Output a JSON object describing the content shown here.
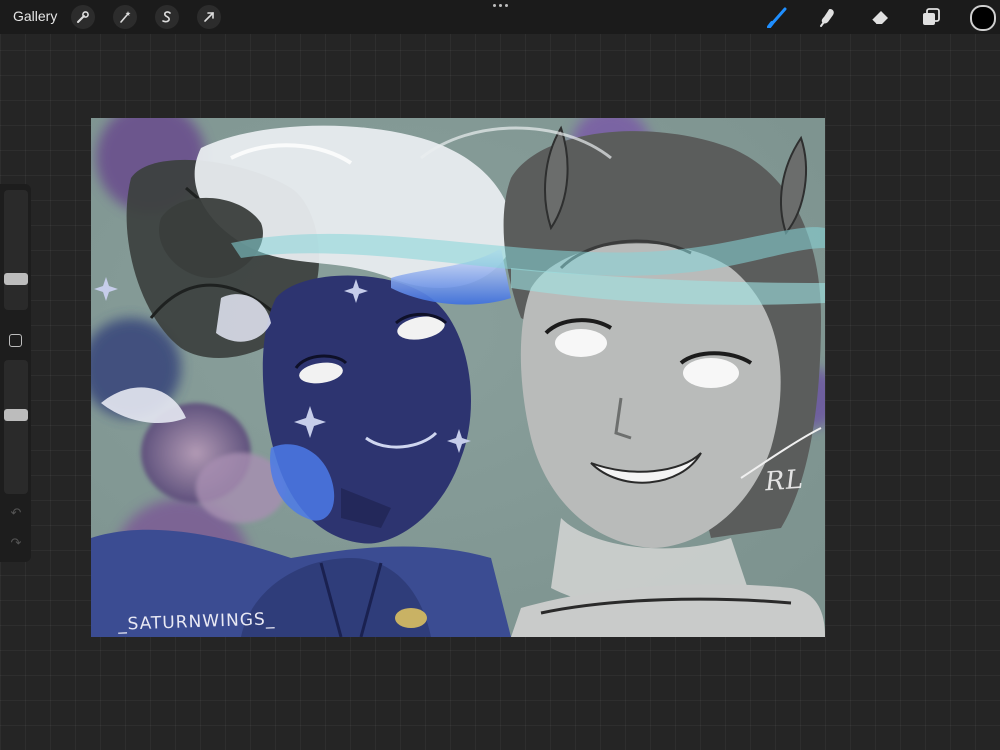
{
  "topbar": {
    "gallery_label": "Gallery",
    "left_tools": [
      {
        "icon": "wrench-icon",
        "label": "Actions"
      },
      {
        "icon": "magic-wand-icon",
        "label": "Adjustments"
      },
      {
        "icon": "selection-s-icon",
        "label": "Selection"
      },
      {
        "icon": "arrow-cursor-icon",
        "label": "Transform"
      }
    ],
    "right_tools": [
      {
        "icon": "brush-icon",
        "active": true
      },
      {
        "icon": "smudge-icon",
        "active": false
      },
      {
        "icon": "eraser-icon",
        "active": false
      },
      {
        "icon": "layers-icon",
        "active": false
      }
    ],
    "active_color": "#000000",
    "accent_color": "#1f8fff"
  },
  "sidebar": {
    "brush_size_level": 0.23,
    "opacity_level": 0.6
  },
  "canvas": {
    "watermark": "_SATURNWINGS_",
    "signature": "RL"
  }
}
